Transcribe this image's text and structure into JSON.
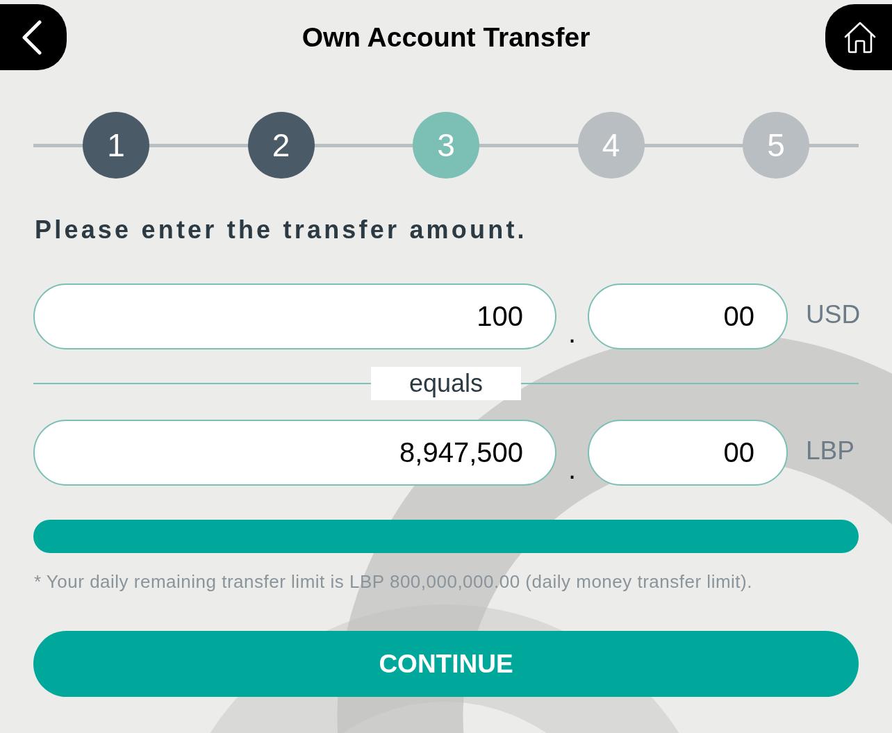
{
  "header": {
    "title": "Own Account Transfer"
  },
  "steps": [
    {
      "label": "1",
      "completed": true,
      "selected": false
    },
    {
      "label": "2",
      "completed": true,
      "selected": false
    },
    {
      "label": "3",
      "completed": false,
      "selected": true
    },
    {
      "label": "4",
      "completed": false,
      "selected": false
    },
    {
      "label": "5",
      "completed": false,
      "selected": false
    }
  ],
  "prompt": "Please enter the transfer amount.",
  "source_amount": {
    "whole": "100",
    "separator": ".",
    "cents": "00",
    "currency": "USD"
  },
  "equals_label": "equals",
  "target_amount": {
    "whole": "8,947,500",
    "separator": ".",
    "cents": "00",
    "currency": "LBP"
  },
  "note": "* Your daily remaining transfer limit is LBP 800,000,000.00 (daily money transfer limit).",
  "continue_button": {
    "label": "CONTINUE"
  }
}
